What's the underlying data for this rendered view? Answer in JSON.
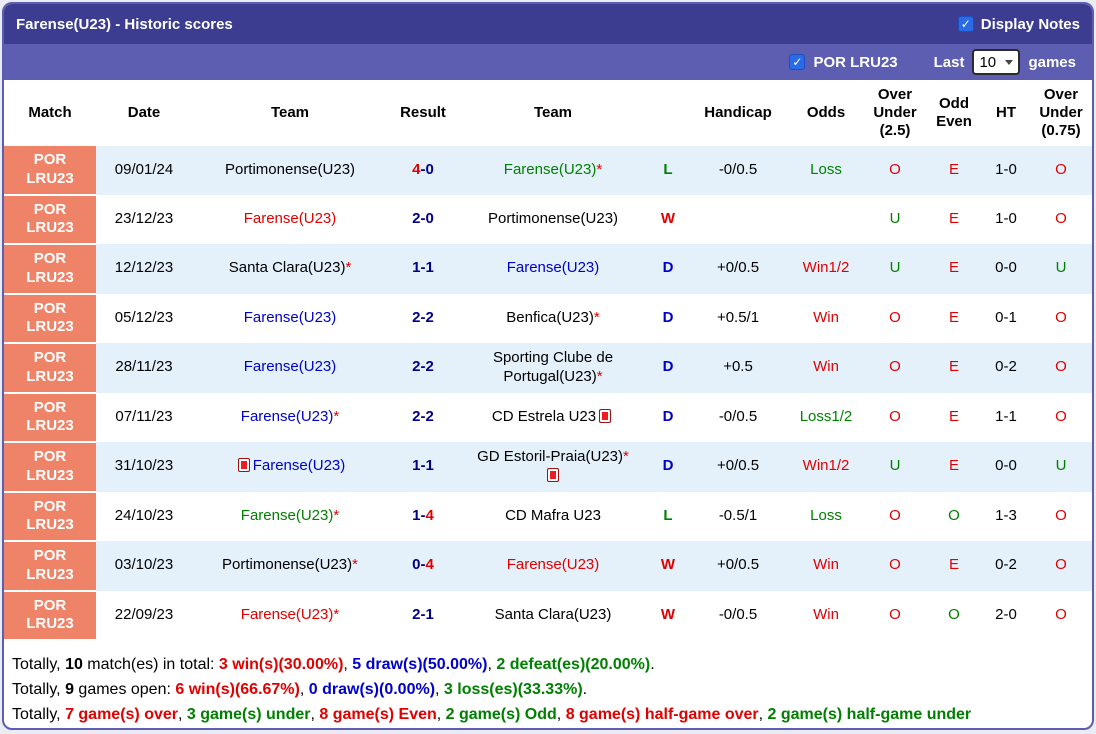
{
  "page": {
    "title": "Farense(U23) - Historic scores"
  },
  "controls": {
    "display_notes": {
      "label": "Display Notes",
      "checked": true
    },
    "league_filter": {
      "label": "POR LRU23",
      "checked": true
    },
    "last_label": "Last",
    "games_count": "10",
    "games_label": "games"
  },
  "colors": {
    "red": "#e10000",
    "green": "#008000",
    "blue": "#0000cc",
    "navy": "#00008b",
    "black": "#000000",
    "salmon": "#ef8368",
    "row_tint": "#e4f1fb",
    "bar_dark": "#3c3c90",
    "bar_light": "#5d5db1",
    "checkbox_blue": "#2b6be8"
  },
  "table": {
    "headers": [
      [
        "Match"
      ],
      [
        "Date"
      ],
      [
        "Team"
      ],
      [
        "Result"
      ],
      [
        "Team"
      ],
      [
        ""
      ],
      [
        "Handicap"
      ],
      [
        "Odds"
      ],
      [
        "Over",
        "Under",
        "(2.5)"
      ],
      [
        "Odd",
        "Even"
      ],
      [
        "HT"
      ],
      [
        "Over",
        "Under",
        "(0.75)"
      ]
    ],
    "rows": [
      {
        "league": [
          "POR",
          "LRU23"
        ],
        "date": "09/01/24",
        "home": {
          "text": "Portimonense(U23)",
          "color": "black"
        },
        "result": [
          {
            "t": "4",
            "c": "red"
          },
          {
            "t": "-",
            "c": "navy"
          },
          {
            "t": "0",
            "c": "navy"
          }
        ],
        "away": {
          "text": "Farense(U23)",
          "color": "green",
          "star": "red"
        },
        "wdl": {
          "t": "L",
          "c": "green"
        },
        "handicap": "-0/0.5",
        "odds": {
          "t": "Loss",
          "c": "green"
        },
        "ou25": {
          "t": "O",
          "c": "red"
        },
        "odd_even": {
          "t": "E",
          "c": "red"
        },
        "ht": "1-0",
        "ou075": {
          "t": "O",
          "c": "red"
        }
      },
      {
        "league": [
          "POR",
          "LRU23"
        ],
        "date": "23/12/23",
        "home": {
          "text": "Farense(U23)",
          "color": "red"
        },
        "result": [
          {
            "t": "2",
            "c": "navy"
          },
          {
            "t": "-",
            "c": "navy"
          },
          {
            "t": "0",
            "c": "navy"
          }
        ],
        "away": {
          "text": "Portimonense(U23)",
          "color": "black"
        },
        "wdl": {
          "t": "W",
          "c": "red"
        },
        "handicap": "",
        "odds": {
          "t": "",
          "c": "black"
        },
        "ou25": {
          "t": "U",
          "c": "green"
        },
        "odd_even": {
          "t": "E",
          "c": "red"
        },
        "ht": "1-0",
        "ou075": {
          "t": "O",
          "c": "red"
        }
      },
      {
        "league": [
          "POR",
          "LRU23"
        ],
        "date": "12/12/23",
        "home": {
          "text": "Santa Clara(U23)",
          "color": "black",
          "star": "red"
        },
        "result": [
          {
            "t": "1",
            "c": "navy"
          },
          {
            "t": "-",
            "c": "navy"
          },
          {
            "t": "1",
            "c": "navy"
          }
        ],
        "away": {
          "text": "Farense(U23)",
          "color": "blue"
        },
        "wdl": {
          "t": "D",
          "c": "blue"
        },
        "handicap": "+0/0.5",
        "odds": {
          "t": "Win1/2",
          "c": "red"
        },
        "ou25": {
          "t": "U",
          "c": "green"
        },
        "odd_even": {
          "t": "E",
          "c": "red"
        },
        "ht": "0-0",
        "ou075": {
          "t": "U",
          "c": "green"
        }
      },
      {
        "league": [
          "POR",
          "LRU23"
        ],
        "date": "05/12/23",
        "home": {
          "text": "Farense(U23)",
          "color": "blue"
        },
        "result": [
          {
            "t": "2",
            "c": "navy"
          },
          {
            "t": "-",
            "c": "navy"
          },
          {
            "t": "2",
            "c": "navy"
          }
        ],
        "away": {
          "text": "Benfica(U23)",
          "color": "black",
          "star": "red"
        },
        "wdl": {
          "t": "D",
          "c": "blue"
        },
        "handicap": "+0.5/1",
        "odds": {
          "t": "Win",
          "c": "red"
        },
        "ou25": {
          "t": "O",
          "c": "red"
        },
        "odd_even": {
          "t": "E",
          "c": "red"
        },
        "ht": "0-1",
        "ou075": {
          "t": "O",
          "c": "red"
        }
      },
      {
        "league": [
          "POR",
          "LRU23"
        ],
        "date": "28/11/23",
        "home": {
          "text": "Farense(U23)",
          "color": "blue"
        },
        "result": [
          {
            "t": "2",
            "c": "navy"
          },
          {
            "t": "-",
            "c": "navy"
          },
          {
            "t": "2",
            "c": "navy"
          }
        ],
        "away": {
          "text": "Sporting Clube de Portugal(U23)",
          "color": "black",
          "star": "red"
        },
        "wdl": {
          "t": "D",
          "c": "blue"
        },
        "handicap": "+0.5",
        "odds": {
          "t": "Win",
          "c": "red"
        },
        "ou25": {
          "t": "O",
          "c": "red"
        },
        "odd_even": {
          "t": "E",
          "c": "red"
        },
        "ht": "0-2",
        "ou075": {
          "t": "O",
          "c": "red"
        }
      },
      {
        "league": [
          "POR",
          "LRU23"
        ],
        "date": "07/11/23",
        "home": {
          "text": "Farense(U23)",
          "color": "blue",
          "star": "red"
        },
        "result": [
          {
            "t": "2",
            "c": "navy"
          },
          {
            "t": "-",
            "c": "navy"
          },
          {
            "t": "2",
            "c": "navy"
          }
        ],
        "away": {
          "text": "CD Estrela U23",
          "color": "black",
          "card": "after"
        },
        "wdl": {
          "t": "D",
          "c": "blue"
        },
        "handicap": "-0/0.5",
        "odds": {
          "t": "Loss1/2",
          "c": "green"
        },
        "ou25": {
          "t": "O",
          "c": "red"
        },
        "odd_even": {
          "t": "E",
          "c": "red"
        },
        "ht": "1-1",
        "ou075": {
          "t": "O",
          "c": "red"
        }
      },
      {
        "league": [
          "POR",
          "LRU23"
        ],
        "date": "31/10/23",
        "home": {
          "text": "Farense(U23)",
          "color": "blue",
          "card": "before"
        },
        "result": [
          {
            "t": "1",
            "c": "navy"
          },
          {
            "t": "-",
            "c": "navy"
          },
          {
            "t": "1",
            "c": "navy"
          }
        ],
        "away": {
          "text": "GD Estoril-Praia(U23)",
          "color": "black",
          "star": "red",
          "card": "below"
        },
        "wdl": {
          "t": "D",
          "c": "blue"
        },
        "handicap": "+0/0.5",
        "odds": {
          "t": "Win1/2",
          "c": "red"
        },
        "ou25": {
          "t": "U",
          "c": "green"
        },
        "odd_even": {
          "t": "E",
          "c": "red"
        },
        "ht": "0-0",
        "ou075": {
          "t": "U",
          "c": "green"
        }
      },
      {
        "league": [
          "POR",
          "LRU23"
        ],
        "date": "24/10/23",
        "home": {
          "text": "Farense(U23)",
          "color": "green",
          "star": "red"
        },
        "result": [
          {
            "t": "1",
            "c": "navy"
          },
          {
            "t": "-",
            "c": "navy"
          },
          {
            "t": "4",
            "c": "red"
          }
        ],
        "away": {
          "text": "CD Mafra U23",
          "color": "black"
        },
        "wdl": {
          "t": "L",
          "c": "green"
        },
        "handicap": "-0.5/1",
        "odds": {
          "t": "Loss",
          "c": "green"
        },
        "ou25": {
          "t": "O",
          "c": "red"
        },
        "odd_even": {
          "t": "O",
          "c": "green"
        },
        "ht": "1-3",
        "ou075": {
          "t": "O",
          "c": "red"
        }
      },
      {
        "league": [
          "POR",
          "LRU23"
        ],
        "date": "03/10/23",
        "home": {
          "text": "Portimonense(U23)",
          "color": "black",
          "star": "red"
        },
        "result": [
          {
            "t": "0",
            "c": "navy"
          },
          {
            "t": "-",
            "c": "navy"
          },
          {
            "t": "4",
            "c": "red"
          }
        ],
        "away": {
          "text": "Farense(U23)",
          "color": "red"
        },
        "wdl": {
          "t": "W",
          "c": "red"
        },
        "handicap": "+0/0.5",
        "odds": {
          "t": "Win",
          "c": "red"
        },
        "ou25": {
          "t": "O",
          "c": "red"
        },
        "odd_even": {
          "t": "E",
          "c": "red"
        },
        "ht": "0-2",
        "ou075": {
          "t": "O",
          "c": "red"
        }
      },
      {
        "league": [
          "POR",
          "LRU23"
        ],
        "date": "22/09/23",
        "home": {
          "text": "Farense(U23)",
          "color": "red",
          "star": "red"
        },
        "result": [
          {
            "t": "2",
            "c": "navy"
          },
          {
            "t": "-",
            "c": "navy"
          },
          {
            "t": "1",
            "c": "navy"
          }
        ],
        "away": {
          "text": "Santa Clara(U23)",
          "color": "black"
        },
        "wdl": {
          "t": "W",
          "c": "red"
        },
        "handicap": "-0/0.5",
        "odds": {
          "t": "Win",
          "c": "red"
        },
        "ou25": {
          "t": "O",
          "c": "red"
        },
        "odd_even": {
          "t": "O",
          "c": "green"
        },
        "ht": "2-0",
        "ou075": {
          "t": "O",
          "c": "red"
        }
      }
    ]
  },
  "summary": [
    [
      {
        "t": "Totally, "
      },
      {
        "t": "10",
        "b": 1
      },
      {
        "t": " match(es) in total: "
      },
      {
        "t": "3 win(s)(30.00%)",
        "c": "red",
        "b": 1
      },
      {
        "t": ", "
      },
      {
        "t": "5 draw(s)(50.00%)",
        "c": "blue",
        "b": 1
      },
      {
        "t": ", "
      },
      {
        "t": "2 defeat(es)(20.00%)",
        "c": "green",
        "b": 1
      },
      {
        "t": "."
      }
    ],
    [
      {
        "t": "Totally, "
      },
      {
        "t": "9",
        "b": 1
      },
      {
        "t": " games open: "
      },
      {
        "t": "6 win(s)(66.67%)",
        "c": "red",
        "b": 1
      },
      {
        "t": ", "
      },
      {
        "t": "0 draw(s)(0.00%)",
        "c": "blue",
        "b": 1
      },
      {
        "t": ", "
      },
      {
        "t": "3 loss(es)(33.33%)",
        "c": "green",
        "b": 1
      },
      {
        "t": "."
      }
    ],
    [
      {
        "t": "Totally, "
      },
      {
        "t": "7 game(s) over",
        "c": "red",
        "b": 1
      },
      {
        "t": ", "
      },
      {
        "t": "3 game(s) under",
        "c": "green",
        "b": 1
      },
      {
        "t": ", "
      },
      {
        "t": "8 game(s) Even",
        "c": "red",
        "b": 1
      },
      {
        "t": ", "
      },
      {
        "t": "2 game(s) Odd",
        "c": "green",
        "b": 1
      },
      {
        "t": ", "
      },
      {
        "t": "8 game(s) half-game over",
        "c": "red",
        "b": 1
      },
      {
        "t": ", "
      },
      {
        "t": "2 game(s) half-game under",
        "c": "green",
        "b": 1
      }
    ]
  ]
}
